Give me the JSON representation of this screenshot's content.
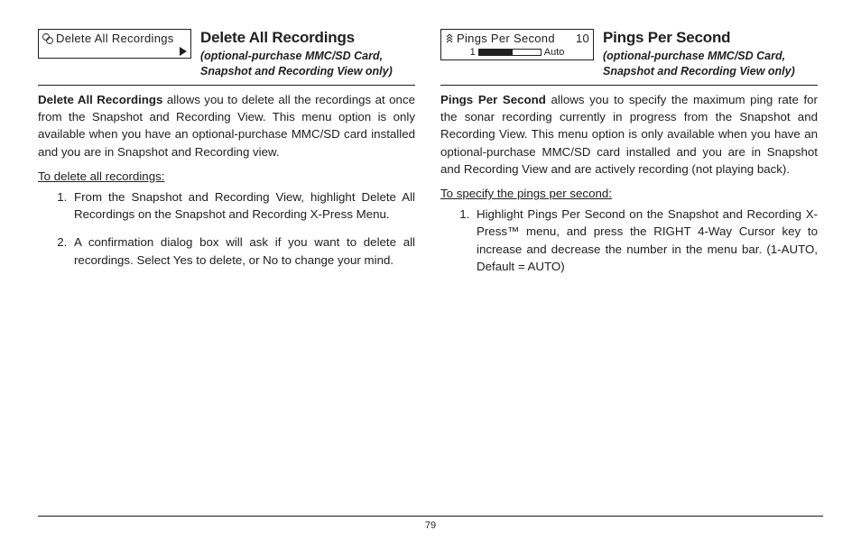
{
  "page_number": "79",
  "left": {
    "menu_label": "Delete All Recordings",
    "title": "Delete All Recordings",
    "subtitle_line1": "(optional-purchase MMC/SD Card,",
    "subtitle_line2": "Snapshot and Recording View only)",
    "para_lead": "Delete All Recordings",
    "para_rest": " allows you to delete all the recordings at once from the Snapshot and Recording View. This menu option is only available when you have an optional-purchase MMC/SD card installed and you are in Snapshot and Recording view.",
    "instr": "To delete all recordings:",
    "steps": [
      "From the Snapshot and Recording View, highlight Delete All Recordings on the Snapshot and Recording X-Press Menu.",
      "A confirmation dialog box will ask if you want to delete all recordings. Select Yes to delete, or No to change your mind."
    ]
  },
  "right": {
    "menu_label": "Pings Per Second",
    "menu_value": "10",
    "slider_min": "1",
    "slider_max": "Auto",
    "title": "Pings Per Second",
    "subtitle_line1": "(optional-purchase MMC/SD Card,",
    "subtitle_line2": "Snapshot and Recording View only)",
    "para_lead": "Pings Per Second",
    "para_rest": " allows you to specify the maximum ping rate for the sonar recording currently in progress from the Snapshot and Recording View. This menu option is only available when you have an optional-purchase MMC/SD card installed and you are in Snapshot and Recording View and are actively recording (not playing back).",
    "instr": "To specify the pings per second:",
    "steps": [
      "Highlight Pings Per Second on the Snapshot and Recording X-Press™ menu, and press the RIGHT 4-Way Cursor key to increase and decrease the number in the menu bar. (1-AUTO, Default = AUTO)"
    ]
  }
}
